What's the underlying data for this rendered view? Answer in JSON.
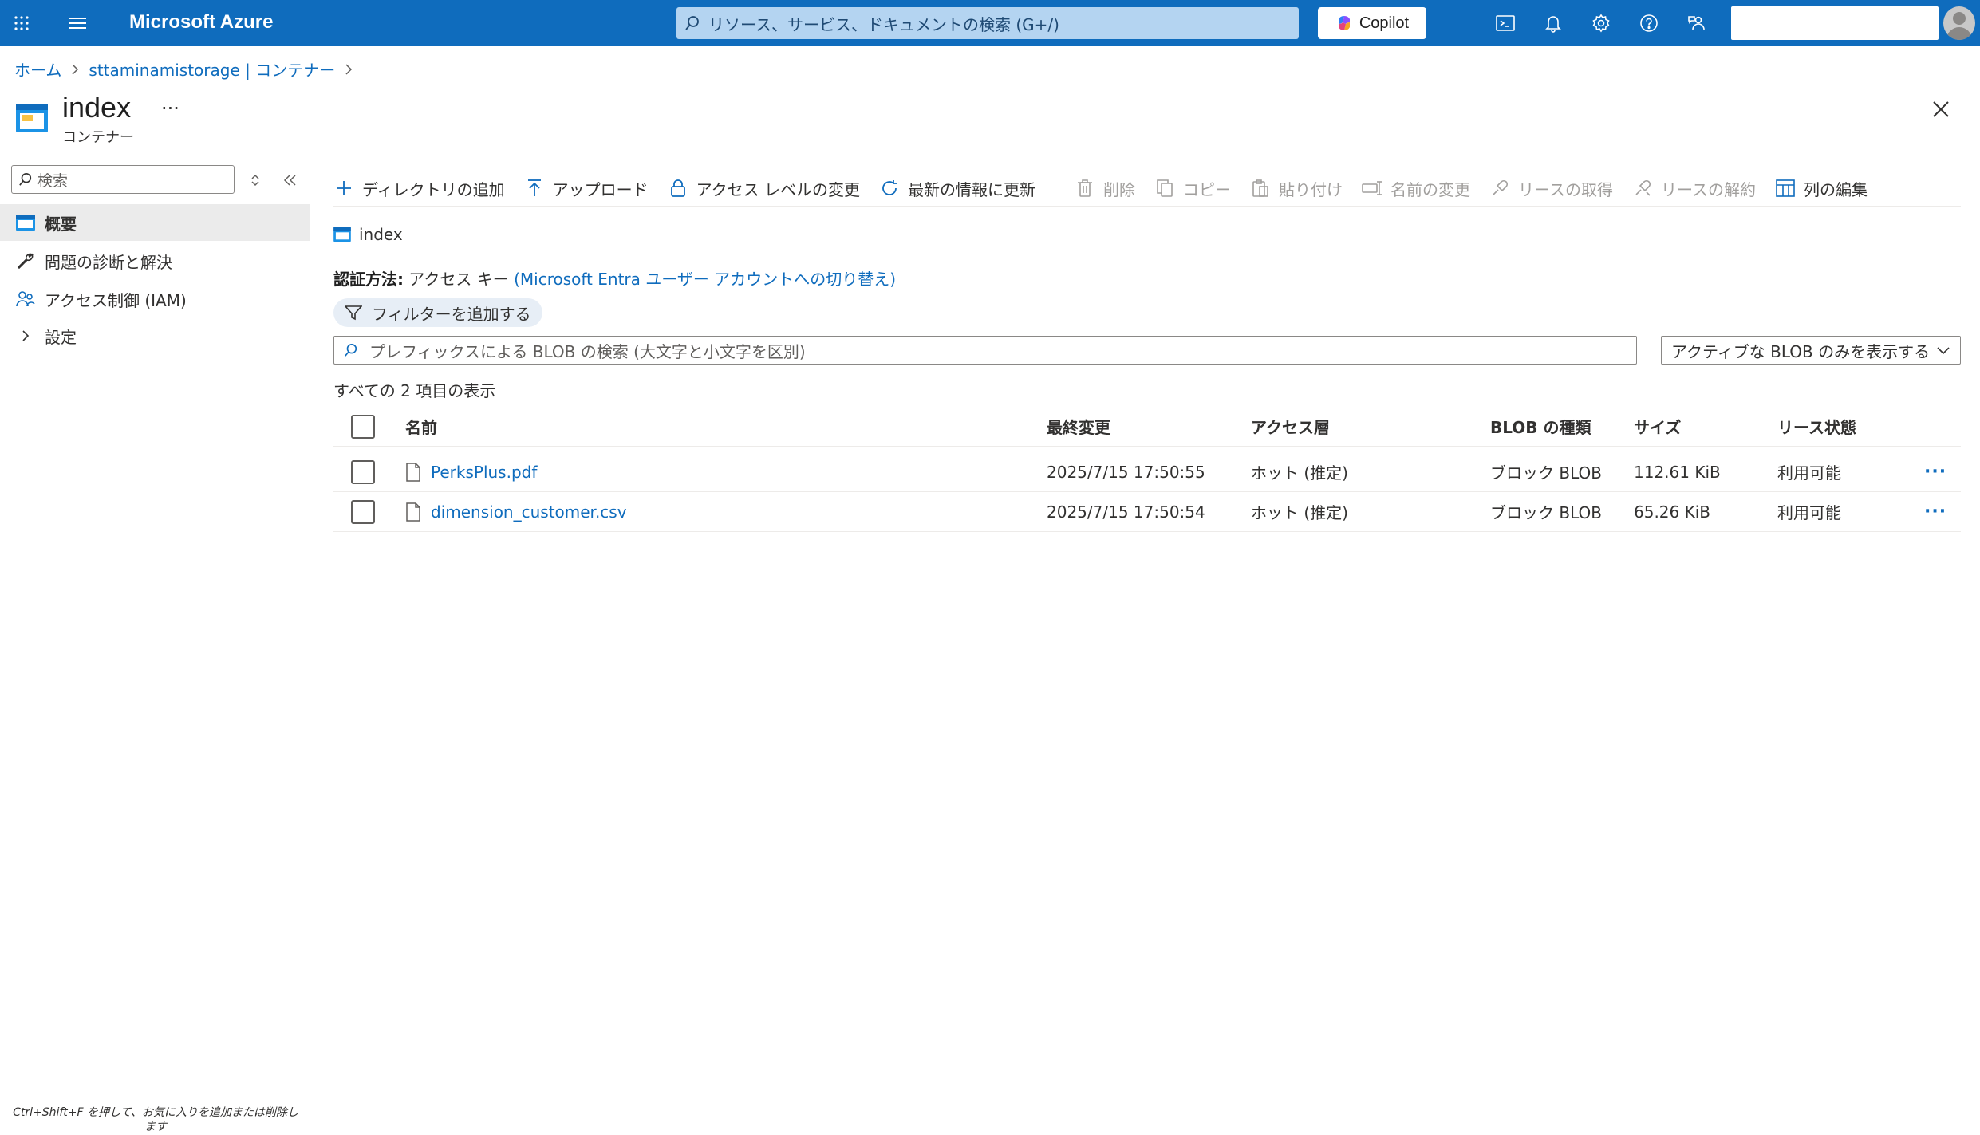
{
  "topbar": {
    "brand": "Microsoft Azure",
    "search_placeholder": "リソース、サービス、ドキュメントの検索 (G+/)",
    "copilot_label": "Copilot",
    "icons": [
      "waffle-icon",
      "hamburger-icon",
      "cloud-shell-icon",
      "bell-icon",
      "gear-icon",
      "help-icon",
      "feedback-icon"
    ]
  },
  "breadcrumb": {
    "home": "ホーム",
    "storage": "sttaminamistorage | コンテナー"
  },
  "header": {
    "title": "index",
    "subtitle": "コンテナー",
    "more": "···"
  },
  "sidebar": {
    "search_placeholder": "検索",
    "items": [
      {
        "label": "概要",
        "icon": "container-icon",
        "active": true
      },
      {
        "label": "問題の診断と解決",
        "icon": "wrench-icon"
      },
      {
        "label": "アクセス制御 (IAM)",
        "icon": "people-icon"
      },
      {
        "label": "設定",
        "icon": "chevron-right-icon"
      }
    ]
  },
  "commands": {
    "add_directory": "ディレクトリの追加",
    "upload": "アップロード",
    "change_access": "アクセス レベルの変更",
    "refresh": "最新の情報に更新",
    "delete": "削除",
    "copy": "コピー",
    "paste": "貼り付け",
    "rename": "名前の変更",
    "acquire_lease": "リースの取得",
    "break_lease": "リースの解約",
    "edit_columns": "列の編集"
  },
  "main": {
    "container_name": "index",
    "auth_label": "認証方法:",
    "auth_value": "アクセス キー",
    "auth_switch": "(Microsoft Entra ユーザー アカウントへの切り替え)",
    "filter_label": "フィルターを追加する",
    "blob_search_placeholder": "プレフィックスによる BLOB の検索 (大文字と小文字を区別)",
    "blob_filter_selected": "アクティブな BLOB のみを表示する",
    "count_text": "すべての 2 項目の表示"
  },
  "table": {
    "columns": [
      "名前",
      "最終変更",
      "アクセス層",
      "BLOB の種類",
      "サイズ",
      "リース状態"
    ],
    "rows": [
      {
        "name": "PerksPlus.pdf",
        "modified": "2025/7/15 17:50:55",
        "tier": "ホット (推定)",
        "type": "ブロック BLOB",
        "size": "112.61 KiB",
        "lease": "利用可能",
        "more": "···"
      },
      {
        "name": "dimension_customer.csv",
        "modified": "2025/7/15 17:50:54",
        "tier": "ホット (推定)",
        "type": "ブロック BLOB",
        "size": "65.26 KiB",
        "lease": "利用可能",
        "more": "···"
      }
    ]
  },
  "footer": {
    "hint": "Ctrl+Shift+F を押して、お気に入りを追加または削除します"
  },
  "colors": {
    "brand_blue": "#0f6cbd",
    "search_fill": "#b4d4f1",
    "nav_active": "#ebebeb"
  }
}
